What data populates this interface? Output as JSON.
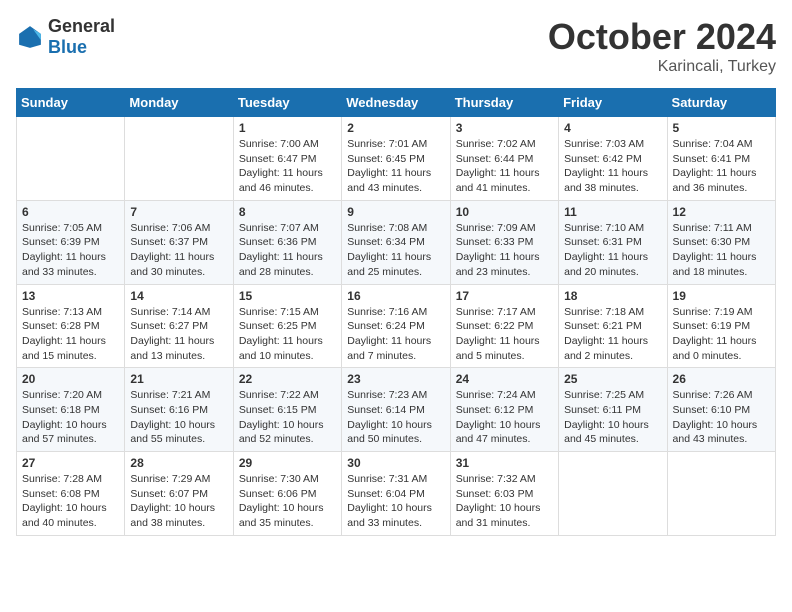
{
  "header": {
    "logo_general": "General",
    "logo_blue": "Blue",
    "month": "October 2024",
    "location": "Karincali, Turkey"
  },
  "weekdays": [
    "Sunday",
    "Monday",
    "Tuesday",
    "Wednesday",
    "Thursday",
    "Friday",
    "Saturday"
  ],
  "weeks": [
    [
      {
        "day": "",
        "sunrise": "",
        "sunset": "",
        "daylight": ""
      },
      {
        "day": "",
        "sunrise": "",
        "sunset": "",
        "daylight": ""
      },
      {
        "day": "1",
        "sunrise": "Sunrise: 7:00 AM",
        "sunset": "Sunset: 6:47 PM",
        "daylight": "Daylight: 11 hours and 46 minutes."
      },
      {
        "day": "2",
        "sunrise": "Sunrise: 7:01 AM",
        "sunset": "Sunset: 6:45 PM",
        "daylight": "Daylight: 11 hours and 43 minutes."
      },
      {
        "day": "3",
        "sunrise": "Sunrise: 7:02 AM",
        "sunset": "Sunset: 6:44 PM",
        "daylight": "Daylight: 11 hours and 41 minutes."
      },
      {
        "day": "4",
        "sunrise": "Sunrise: 7:03 AM",
        "sunset": "Sunset: 6:42 PM",
        "daylight": "Daylight: 11 hours and 38 minutes."
      },
      {
        "day": "5",
        "sunrise": "Sunrise: 7:04 AM",
        "sunset": "Sunset: 6:41 PM",
        "daylight": "Daylight: 11 hours and 36 minutes."
      }
    ],
    [
      {
        "day": "6",
        "sunrise": "Sunrise: 7:05 AM",
        "sunset": "Sunset: 6:39 PM",
        "daylight": "Daylight: 11 hours and 33 minutes."
      },
      {
        "day": "7",
        "sunrise": "Sunrise: 7:06 AM",
        "sunset": "Sunset: 6:37 PM",
        "daylight": "Daylight: 11 hours and 30 minutes."
      },
      {
        "day": "8",
        "sunrise": "Sunrise: 7:07 AM",
        "sunset": "Sunset: 6:36 PM",
        "daylight": "Daylight: 11 hours and 28 minutes."
      },
      {
        "day": "9",
        "sunrise": "Sunrise: 7:08 AM",
        "sunset": "Sunset: 6:34 PM",
        "daylight": "Daylight: 11 hours and 25 minutes."
      },
      {
        "day": "10",
        "sunrise": "Sunrise: 7:09 AM",
        "sunset": "Sunset: 6:33 PM",
        "daylight": "Daylight: 11 hours and 23 minutes."
      },
      {
        "day": "11",
        "sunrise": "Sunrise: 7:10 AM",
        "sunset": "Sunset: 6:31 PM",
        "daylight": "Daylight: 11 hours and 20 minutes."
      },
      {
        "day": "12",
        "sunrise": "Sunrise: 7:11 AM",
        "sunset": "Sunset: 6:30 PM",
        "daylight": "Daylight: 11 hours and 18 minutes."
      }
    ],
    [
      {
        "day": "13",
        "sunrise": "Sunrise: 7:13 AM",
        "sunset": "Sunset: 6:28 PM",
        "daylight": "Daylight: 11 hours and 15 minutes."
      },
      {
        "day": "14",
        "sunrise": "Sunrise: 7:14 AM",
        "sunset": "Sunset: 6:27 PM",
        "daylight": "Daylight: 11 hours and 13 minutes."
      },
      {
        "day": "15",
        "sunrise": "Sunrise: 7:15 AM",
        "sunset": "Sunset: 6:25 PM",
        "daylight": "Daylight: 11 hours and 10 minutes."
      },
      {
        "day": "16",
        "sunrise": "Sunrise: 7:16 AM",
        "sunset": "Sunset: 6:24 PM",
        "daylight": "Daylight: 11 hours and 7 minutes."
      },
      {
        "day": "17",
        "sunrise": "Sunrise: 7:17 AM",
        "sunset": "Sunset: 6:22 PM",
        "daylight": "Daylight: 11 hours and 5 minutes."
      },
      {
        "day": "18",
        "sunrise": "Sunrise: 7:18 AM",
        "sunset": "Sunset: 6:21 PM",
        "daylight": "Daylight: 11 hours and 2 minutes."
      },
      {
        "day": "19",
        "sunrise": "Sunrise: 7:19 AM",
        "sunset": "Sunset: 6:19 PM",
        "daylight": "Daylight: 11 hours and 0 minutes."
      }
    ],
    [
      {
        "day": "20",
        "sunrise": "Sunrise: 7:20 AM",
        "sunset": "Sunset: 6:18 PM",
        "daylight": "Daylight: 10 hours and 57 minutes."
      },
      {
        "day": "21",
        "sunrise": "Sunrise: 7:21 AM",
        "sunset": "Sunset: 6:16 PM",
        "daylight": "Daylight: 10 hours and 55 minutes."
      },
      {
        "day": "22",
        "sunrise": "Sunrise: 7:22 AM",
        "sunset": "Sunset: 6:15 PM",
        "daylight": "Daylight: 10 hours and 52 minutes."
      },
      {
        "day": "23",
        "sunrise": "Sunrise: 7:23 AM",
        "sunset": "Sunset: 6:14 PM",
        "daylight": "Daylight: 10 hours and 50 minutes."
      },
      {
        "day": "24",
        "sunrise": "Sunrise: 7:24 AM",
        "sunset": "Sunset: 6:12 PM",
        "daylight": "Daylight: 10 hours and 47 minutes."
      },
      {
        "day": "25",
        "sunrise": "Sunrise: 7:25 AM",
        "sunset": "Sunset: 6:11 PM",
        "daylight": "Daylight: 10 hours and 45 minutes."
      },
      {
        "day": "26",
        "sunrise": "Sunrise: 7:26 AM",
        "sunset": "Sunset: 6:10 PM",
        "daylight": "Daylight: 10 hours and 43 minutes."
      }
    ],
    [
      {
        "day": "27",
        "sunrise": "Sunrise: 7:28 AM",
        "sunset": "Sunset: 6:08 PM",
        "daylight": "Daylight: 10 hours and 40 minutes."
      },
      {
        "day": "28",
        "sunrise": "Sunrise: 7:29 AM",
        "sunset": "Sunset: 6:07 PM",
        "daylight": "Daylight: 10 hours and 38 minutes."
      },
      {
        "day": "29",
        "sunrise": "Sunrise: 7:30 AM",
        "sunset": "Sunset: 6:06 PM",
        "daylight": "Daylight: 10 hours and 35 minutes."
      },
      {
        "day": "30",
        "sunrise": "Sunrise: 7:31 AM",
        "sunset": "Sunset: 6:04 PM",
        "daylight": "Daylight: 10 hours and 33 minutes."
      },
      {
        "day": "31",
        "sunrise": "Sunrise: 7:32 AM",
        "sunset": "Sunset: 6:03 PM",
        "daylight": "Daylight: 10 hours and 31 minutes."
      },
      {
        "day": "",
        "sunrise": "",
        "sunset": "",
        "daylight": ""
      },
      {
        "day": "",
        "sunrise": "",
        "sunset": "",
        "daylight": ""
      }
    ]
  ]
}
